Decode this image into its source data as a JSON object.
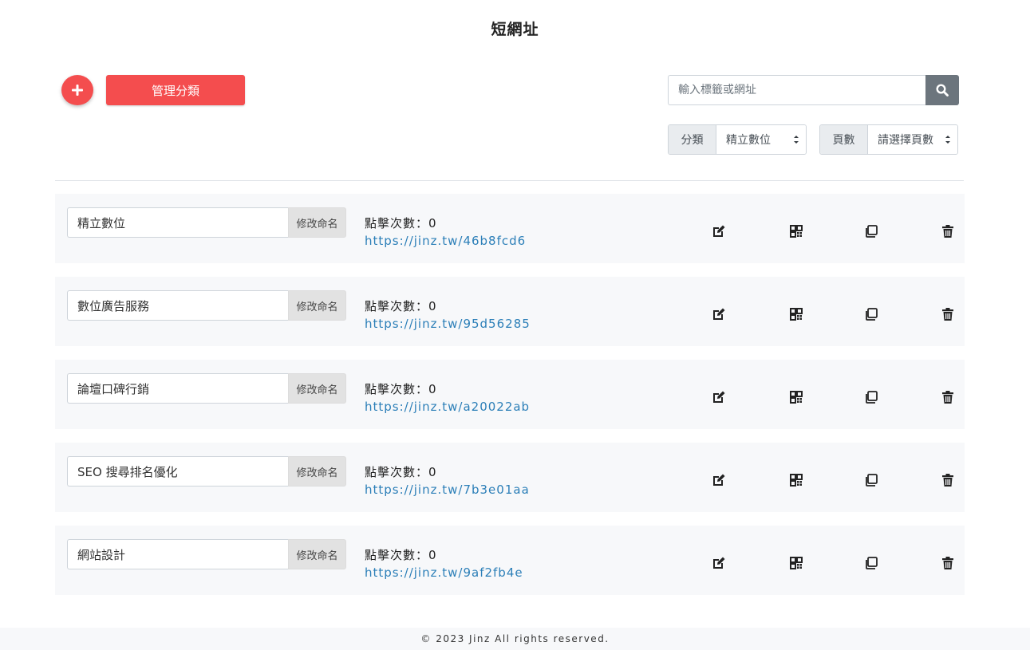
{
  "page": {
    "title": "短網址"
  },
  "toolbar": {
    "manage_label": "管理分類",
    "search_placeholder": "輸入標籤或網址"
  },
  "filters": {
    "category_prefix": "分類",
    "category_value": "精立數位",
    "page_prefix": "頁數",
    "page_value": "請選擇頁數"
  },
  "rows": [
    {
      "name": "精立數位",
      "rename_label": "修改命名",
      "clicks": "點擊次數：0",
      "url": "https://jinz.tw/46b8fcd6"
    },
    {
      "name": "數位廣告服務",
      "rename_label": "修改命名",
      "clicks": "點擊次數：0",
      "url": "https://jinz.tw/95d56285"
    },
    {
      "name": "論壇口碑行銷",
      "rename_label": "修改命名",
      "clicks": "點擊次數：0",
      "url": "https://jinz.tw/a20022ab"
    },
    {
      "name": "SEO 搜尋排名優化",
      "rename_label": "修改命名",
      "clicks": "點擊次數：0",
      "url": "https://jinz.tw/7b3e01aa"
    },
    {
      "name": "網站設計",
      "rename_label": "修改命名",
      "clicks": "點擊次數：0",
      "url": "https://jinz.tw/9af2fb4e"
    }
  ],
  "icons": {
    "add": "plus-icon",
    "search": "search-icon",
    "edit": "edit-icon",
    "qr": "qrcode-icon",
    "copy": "copy-icon",
    "delete": "trash-icon"
  },
  "colors": {
    "accent": "#f44d4e",
    "link": "#2c7fb8",
    "search_button": "#6c757d"
  },
  "footer": {
    "text": "© 2023 Jinz All rights reserved."
  }
}
